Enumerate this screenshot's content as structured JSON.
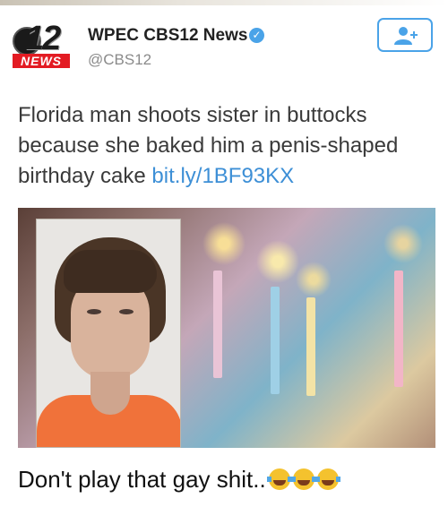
{
  "account": {
    "logo_number": "12",
    "logo_news": "NEWS",
    "name": "WPEC CBS12 News",
    "handle": "@CBS12",
    "verified_icon": "verified-badge-icon",
    "follow_icon": "add-user-icon"
  },
  "tweet": {
    "text": "Florida man shoots sister in buttocks because she baked him a penis-shaped birthday cake ",
    "link": "bit.ly/1BF93KX"
  },
  "caption": {
    "text": "Don't play that gay shit..",
    "emoji": [
      "face-with-tears-of-joy",
      "face-with-tears-of-joy",
      "face-with-tears-of-joy"
    ]
  },
  "colors": {
    "link": "#3d8fd6",
    "follow_border": "#4aa3e8",
    "logo_red": "#e31b23"
  }
}
